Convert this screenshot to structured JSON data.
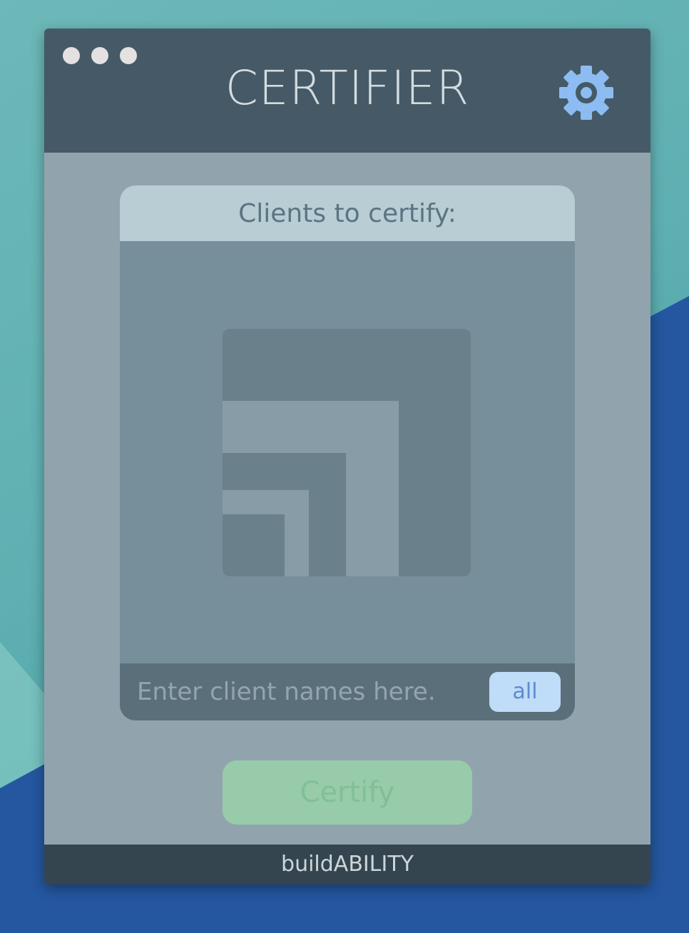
{
  "window": {
    "title": "CERTIFIER",
    "settings_icon": "gear-icon",
    "control_dots": [
      "dot",
      "dot",
      "dot"
    ]
  },
  "clients_panel": {
    "header": "Clients to certify:",
    "empty_state_icon": "placeholder-logo-icon",
    "input": {
      "value": "",
      "placeholder": "Enter client names here."
    },
    "all_button_label": "all"
  },
  "actions": {
    "certify_label": "Certify"
  },
  "footer": {
    "brand": "buildABILITY"
  },
  "colors": {
    "title_bar": "#455a66",
    "content_bg": "#91a4ad",
    "card_header": "#b9cdd5",
    "list_bg": "#778f9a",
    "input_row": "#5b6f7b",
    "all_button": "#bfdcf8",
    "certify_button": "#98cba9",
    "footer": "#35454f",
    "gear": "#8cbcf2"
  }
}
